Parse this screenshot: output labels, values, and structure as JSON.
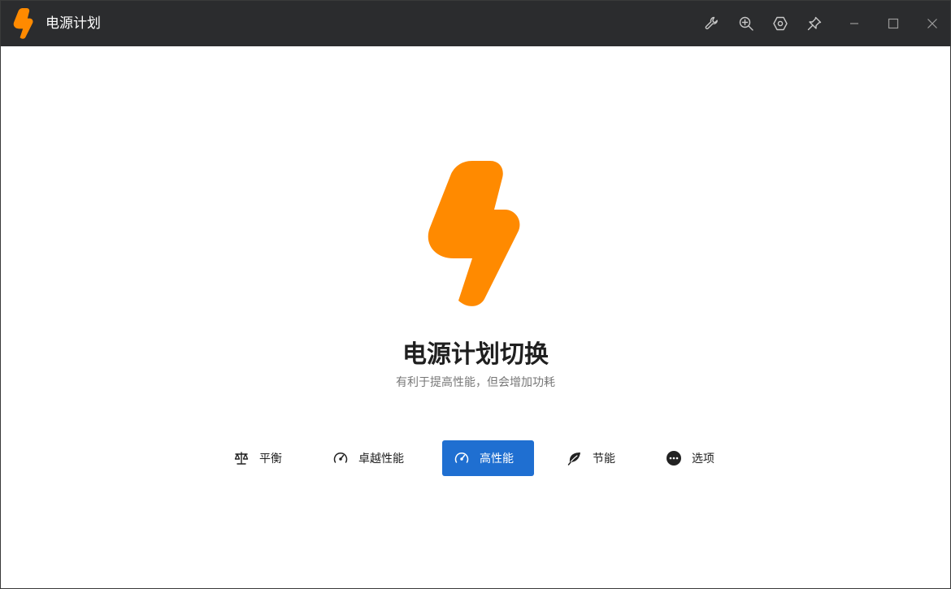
{
  "window": {
    "title": "电源计划",
    "brand_color": "#FF8A00",
    "titlebar_color": "#2B2C2E"
  },
  "titlebar_buttons": [
    {
      "icon": "wrench-icon"
    },
    {
      "icon": "zoom-in-icon"
    },
    {
      "icon": "settings-hexagon-icon"
    },
    {
      "icon": "pin-icon"
    },
    {
      "icon": "minimize-icon"
    },
    {
      "icon": "maximize-icon"
    },
    {
      "icon": "close-icon"
    }
  ],
  "main": {
    "heading": "电源计划切换",
    "subheading": "有利于提高性能，但会增加功耗"
  },
  "plans": [
    {
      "label": "平衡",
      "icon": "scale-icon",
      "active": false
    },
    {
      "label": "卓越性能",
      "icon": "speedometer-icon",
      "active": false
    },
    {
      "label": "高性能",
      "icon": "speedometer-icon",
      "active": true
    },
    {
      "label": "节能",
      "icon": "leaf-icon",
      "active": false
    },
    {
      "label": "选项",
      "icon": "more-options-icon",
      "active": false
    }
  ],
  "accent_color": "#1F6FD1"
}
